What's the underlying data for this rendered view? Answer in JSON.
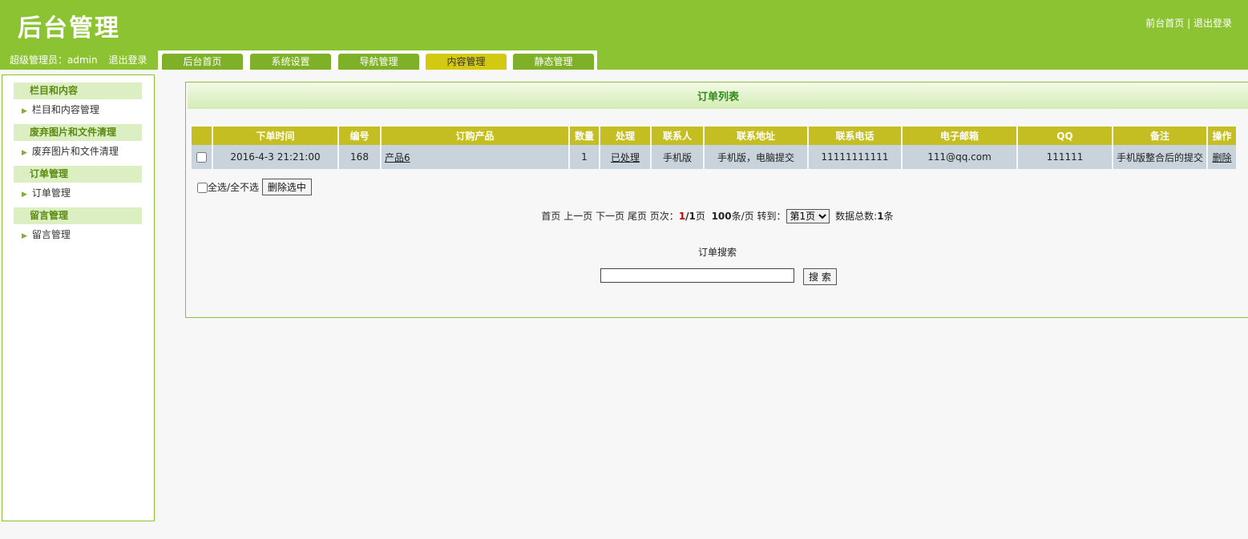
{
  "header": {
    "logo": "后台管理",
    "link_home": "前台首页",
    "link_sep": " | ",
    "link_logout": "退出登录",
    "user_label": "超级管理员：admin",
    "user_logout": "退出登录",
    "tabs": [
      {
        "label": "后台首页"
      },
      {
        "label": "系统设置"
      },
      {
        "label": "导航管理"
      },
      {
        "label": "内容管理",
        "active": true
      },
      {
        "label": "静态管理"
      }
    ]
  },
  "sidebar": {
    "groups": [
      {
        "title": "栏目和内容",
        "item": "栏目和内容管理"
      },
      {
        "title": "废弃图片和文件清理",
        "item": "废弃图片和文件清理"
      },
      {
        "title": "订单管理",
        "item": "订单管理"
      },
      {
        "title": "留言管理",
        "item": "留言管理"
      }
    ]
  },
  "main": {
    "title": "订单列表",
    "columns": [
      "下单时间",
      "编号",
      "订购产品",
      "数量",
      "处理",
      "联系人",
      "联系地址",
      "联系电话",
      "电子邮箱",
      "QQ",
      "备注",
      "操作"
    ],
    "rows": [
      {
        "time": "2016-4-3 21:21:00",
        "id": "168",
        "product": "产品6",
        "qty": "1",
        "status": "已处理",
        "contact": "手机版",
        "address": "手机版，电脑提交",
        "phone": "11111111111",
        "email": "111@qq.com",
        "qq": "111111",
        "note": "手机版整合后的提交",
        "action": "删除"
      }
    ],
    "select_all_label": "全选/全不选",
    "delete_selected": "删除选中",
    "pager": {
      "first": "首页",
      "prev": "上一页",
      "next": "下一页",
      "last": "尾页",
      "page_label": "页次：",
      "current": "1",
      "total_pages": "/1",
      "page_suffix": "页",
      "per_page": "100",
      "per_page_suffix": "条/页",
      "goto_label": "转到：",
      "goto_selected": "第1页",
      "total_label": "数据总数:",
      "total_count": "1",
      "total_suffix": "条"
    },
    "search_label": "订单搜索",
    "search_value": "",
    "search_button": "搜 索"
  },
  "colors": {
    "header_green": "#8cc332",
    "tab_green": "#7fb128",
    "tab_active": "#d3c910",
    "table_header": "#c4be23",
    "row_bg": "#c8d3dc"
  }
}
